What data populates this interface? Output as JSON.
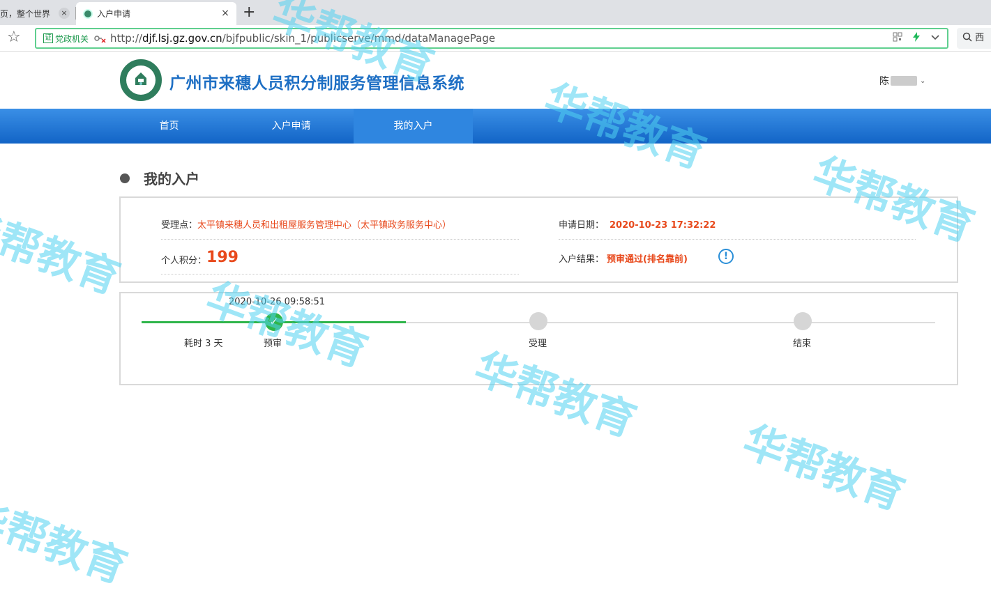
{
  "browser": {
    "tabs": [
      {
        "label": "页，整个世界"
      },
      {
        "label": "入户申请"
      }
    ],
    "new_tab_glyph": "+",
    "close_glyph": "×",
    "star_glyph": "☆",
    "security_badge": "党政机关",
    "cert_glyph": "证",
    "url_prefix": "http://",
    "url_host": "djf.lsj.gz.gov.cn",
    "url_path": "/bjfpublic/skin_1/publicserve/mmd/dataManagePage",
    "search_ext_label": "西",
    "search_icon": "search-icon"
  },
  "site": {
    "title": "广州市来穗人员积分制服务管理信息系统",
    "user_name_prefix": "陈",
    "user_caret": "⌄"
  },
  "nav": {
    "items": [
      {
        "label": "首页"
      },
      {
        "label": "入户申请"
      },
      {
        "label": "我的入户"
      }
    ],
    "active_index": 2
  },
  "section": {
    "title": "我的入户"
  },
  "info": {
    "office_label": "受理点：",
    "office_value": "太平镇来穗人员和出租屋服务管理中心（太平镇政务服务中心）",
    "apply_date_label": "申请日期：",
    "apply_date_value": "2020-10-23 17:32:22",
    "score_label": "个人积分：",
    "score_value": "199",
    "result_label": "入户结果：",
    "result_value": "预审通过(排名靠前)",
    "info_icon_glyph": "!"
  },
  "progress": {
    "timestamp": "2020-10-26 09:58:51",
    "elapsed": "耗时 3 天",
    "check_glyph": "✓",
    "steps": [
      {
        "label": "预审",
        "done": true
      },
      {
        "label": "受理",
        "done": false
      },
      {
        "label": "结束",
        "done": false
      }
    ]
  },
  "watermark": {
    "text": "华帮教育"
  },
  "colors": {
    "nav_blue": "#1e6fc4",
    "accent_red": "#e8491c",
    "progress_green": "#2fb54a",
    "url_border_green": "#5fcf8f",
    "watermark_cyan": "#50d2f0"
  }
}
